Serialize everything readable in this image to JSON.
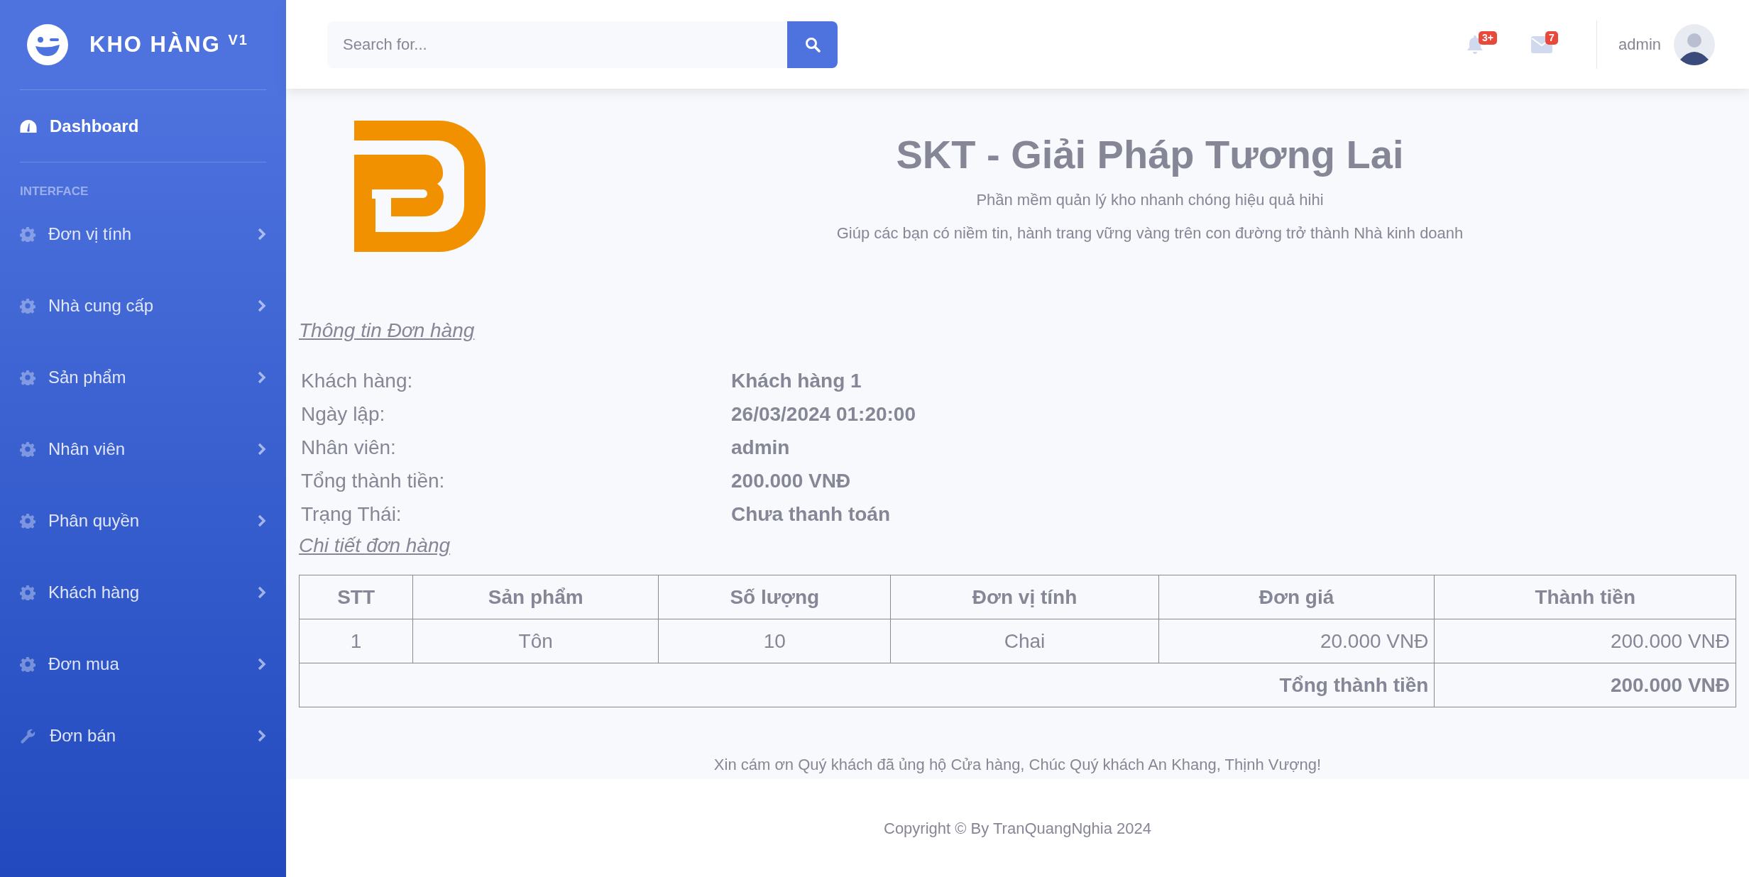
{
  "sidebar": {
    "brand": {
      "title": "KHO HÀNG",
      "version": "V1"
    },
    "dashboard": {
      "label": "Dashboard",
      "selected": true
    },
    "section": "INTERFACE",
    "menu": [
      {
        "label": "Đơn vị tính",
        "kind": "gear",
        "selected": false
      },
      {
        "label": "Nhà cung cấp",
        "kind": "gear",
        "selected": false
      },
      {
        "label": "Sản phẩm",
        "kind": "gear",
        "selected": false
      },
      {
        "label": "Nhân viên",
        "kind": "gear",
        "selected": false
      },
      {
        "label": "Phân quyền",
        "kind": "gear",
        "selected": false
      },
      {
        "label": "Khách hàng",
        "kind": "gear",
        "selected": false
      },
      {
        "label": "Đơn mua",
        "kind": "gear",
        "selected": false
      },
      {
        "label": "Đơn bán",
        "kind": "wrench",
        "selected": false
      }
    ]
  },
  "topbar": {
    "search": {
      "placeholder": "Search for..."
    },
    "alerts": [
      {
        "kind": "bell",
        "badge": "3+"
      },
      {
        "kind": "envelope",
        "badge": "7"
      }
    ],
    "user": "admin"
  },
  "banner": {
    "title": "SKT - Giải Pháp Tương Lai",
    "lines": [
      "Phần mềm quản lý kho nhanh chóng hiệu quả hihi",
      "Giúp các bạn có niềm tin, hành trang vững vàng trên con đường trở thành Nhà kinh doanh"
    ]
  },
  "order_info": {
    "heading": "Thông tin Đơn hàng",
    "fields": [
      {
        "label": "Khách hàng:",
        "value": "Khách hàng 1"
      },
      {
        "label": "Ngày lập:",
        "value": "26/03/2024 01:20:00"
      },
      {
        "label": "Nhân viên:",
        "value": "admin"
      },
      {
        "label": "Tổng thành tiền:",
        "value": "200.000 VNĐ"
      },
      {
        "label": "Trạng Thái:",
        "value": "Chưa thanh toán"
      }
    ]
  },
  "details": {
    "heading": "Chi tiết đơn hàng",
    "table": {
      "columns": [
        "STT",
        "Sản phẩm",
        "Số lượng",
        "Đơn vị tính",
        "Đơn giá",
        "Thành tiền"
      ],
      "rows": [
        [
          "1",
          "Tôn",
          "10",
          "Chai",
          "20.000 VNĐ",
          "200.000 VNĐ"
        ]
      ],
      "total": {
        "label": "Tổng thành tiền",
        "value": "200.000 VNĐ"
      }
    }
  },
  "thanks": "Xin cám ơn Quý khách đã ủng hộ Cửa hàng, Chúc Quý khách An Khang, Thịnh Vượng!",
  "copyright": "Copyright © By TranQuangNghia 2024"
}
